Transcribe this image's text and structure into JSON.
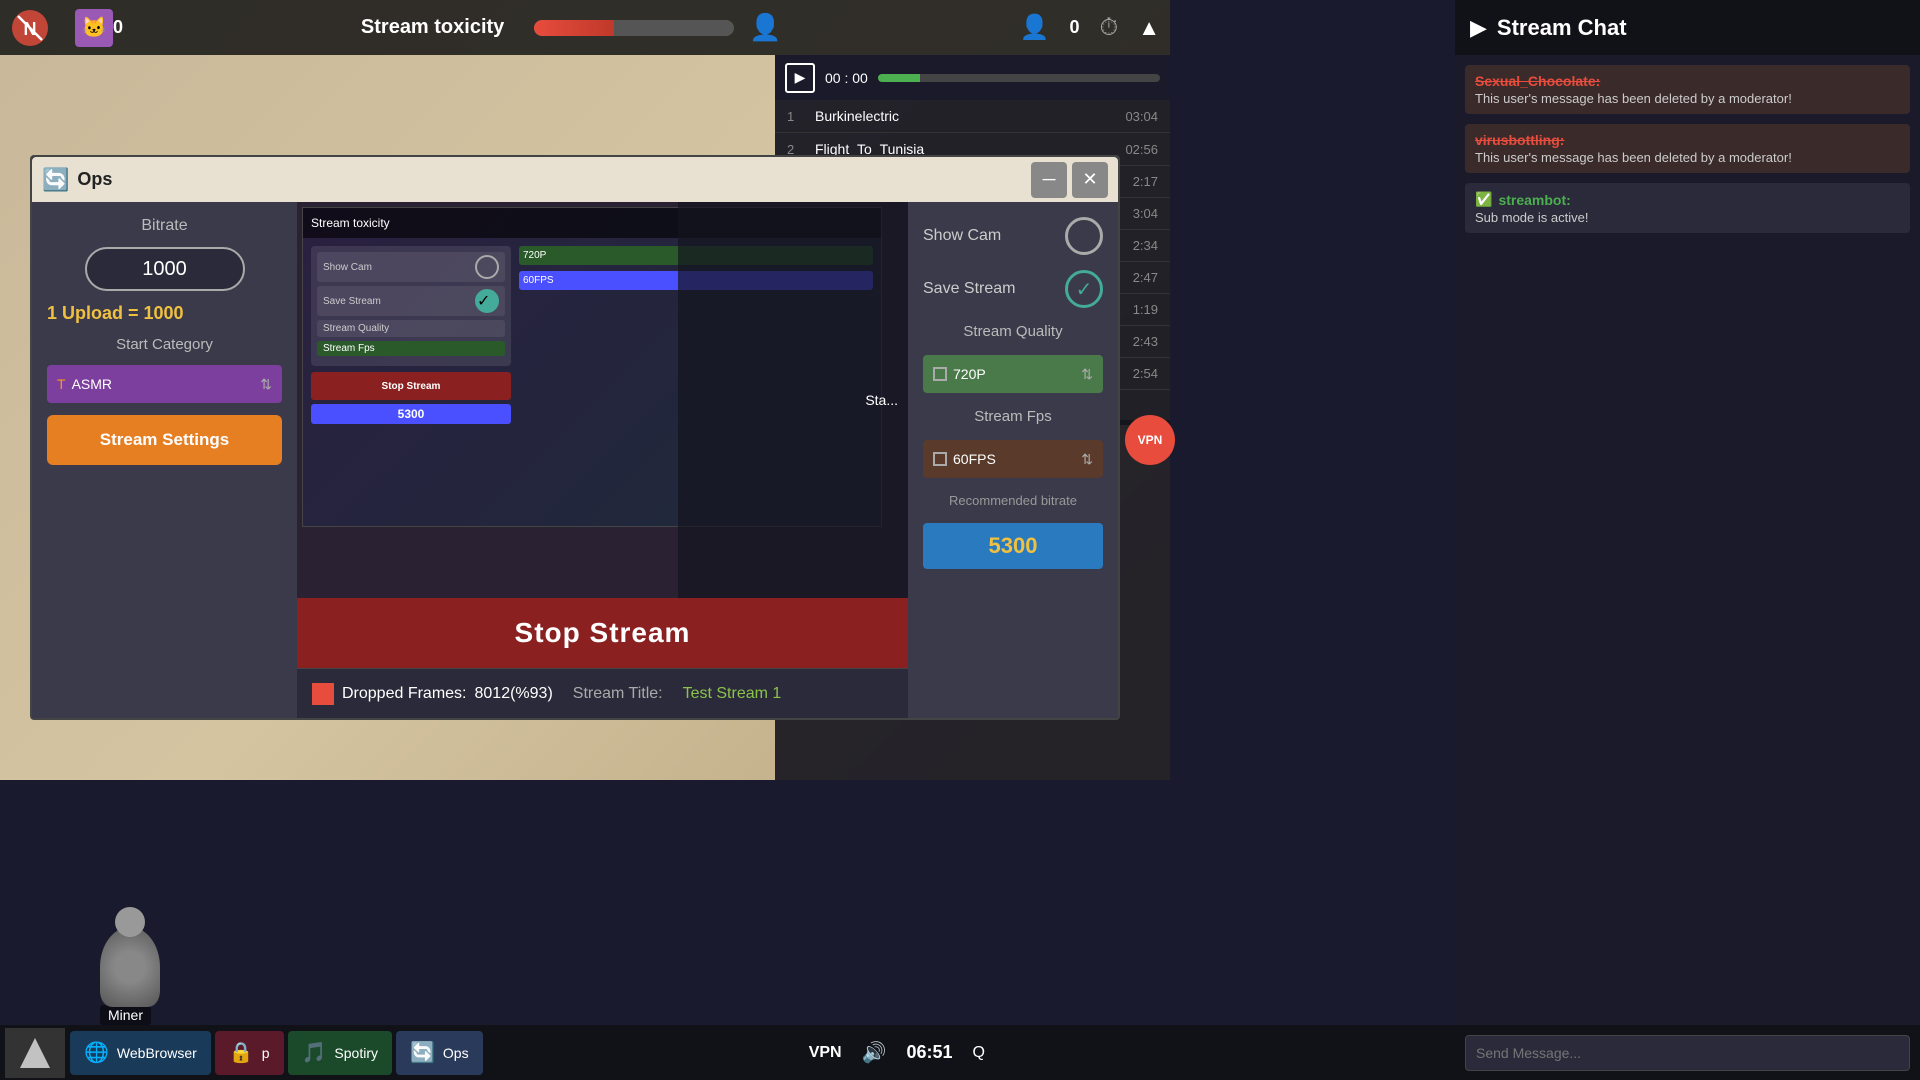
{
  "app": {
    "title": "Ops"
  },
  "topbar": {
    "stream_toxicity": "Stream toxicity",
    "follower_count": "0",
    "viewer_count": "0",
    "cat_icon": "🐱",
    "person_icon": "👤",
    "timer_icon": "⏱"
  },
  "stream_list": {
    "time": "00 : 00",
    "items": [
      {
        "num": "1",
        "name": "Burkinelectric",
        "time": "03:04"
      },
      {
        "num": "2",
        "name": "Flight_To_Tunisia",
        "time": "02:56"
      },
      {
        "num": "",
        "name": "",
        "time": "2:17"
      },
      {
        "num": "",
        "name": "",
        "time": "3:04"
      },
      {
        "num": "",
        "name": "",
        "time": "2:34"
      },
      {
        "num": "",
        "name": "",
        "time": "2:47"
      },
      {
        "num": "",
        "name": "",
        "time": "1:19"
      },
      {
        "num": "",
        "name": "",
        "time": "2:43"
      },
      {
        "num": "",
        "name": "",
        "time": "2:54"
      }
    ]
  },
  "stream_settings": {
    "panel_title": "Ops",
    "bitrate_label": "Bitrate",
    "bitrate_value": "1000",
    "upload_label": "1 Upload = 1000",
    "start_category_label": "Start Category",
    "category_value": "ASMR",
    "stream_settings_btn": "Stream Settings",
    "stop_stream_btn": "Stop Stream",
    "dropped_frames_label": "Dropped Frames:",
    "dropped_frames_value": "8012(%93)",
    "stream_title_label": "Stream Title:",
    "stream_title_value": "Test Stream 1"
  },
  "right_panel": {
    "show_cam_label": "Show Cam",
    "save_stream_label": "Save Stream",
    "stream_quality_label": "Stream Quality",
    "quality_value": "720P",
    "stream_fps_label": "Stream Fps",
    "fps_value": "60FPS",
    "recommended_label": "Recommended bitrate",
    "recommended_value": "5300"
  },
  "nested_preview": {
    "stop_stream": "Stop Stream",
    "bitrate_display": "5300",
    "show_cam": "Show Cam",
    "save_stream": "Save Stream",
    "stream_quality": "Stream Quality",
    "stream_fps": "Stream Fps",
    "top_label": "Stream toxicity"
  },
  "chat": {
    "title": "Stream Chat",
    "messages": [
      {
        "username": "Sexual_Chocolate",
        "username_style": "strikethrough",
        "text": "This user's message has been deleted by a moderator!",
        "deleted": true
      },
      {
        "username": "virusbottling",
        "username_style": "strikethrough",
        "text": "This user's message has been deleted by a moderator!",
        "deleted": true
      },
      {
        "username": "streambot",
        "username_style": "green",
        "text": "Sub mode is active!",
        "deleted": false
      }
    ],
    "input_placeholder": "Send Message..."
  },
  "status": {
    "label": "Statu"
  },
  "taskbar": {
    "apps": [
      {
        "name": "WebBrowser",
        "icon": "🌐",
        "class": "app-webbrowser"
      },
      {
        "name": "p",
        "icon": "🔒",
        "class": "app-p"
      },
      {
        "name": "Spotiry",
        "icon": "🎵",
        "class": "app-spotiry"
      },
      {
        "name": "Ops",
        "icon": "🔄",
        "class": "app-ops"
      }
    ],
    "vpn": "VPN",
    "volume_icon": "🔊",
    "time": "06:51",
    "extra_icon": "Q"
  },
  "character": {
    "name": "Miner"
  }
}
